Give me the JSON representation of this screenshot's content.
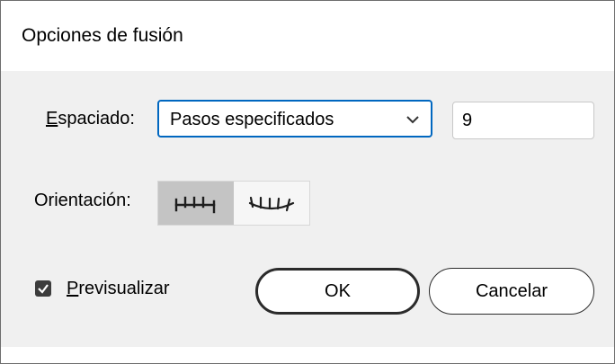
{
  "dialog": {
    "title": "Opciones de fusión"
  },
  "spacing": {
    "label_first": "E",
    "label_rest": "spaciado:",
    "selected_option": "Pasos especificados",
    "value": "9"
  },
  "orientation": {
    "label": "Orientación:",
    "options": [
      {
        "icon": "align-to-page-icon",
        "selected": true
      },
      {
        "icon": "align-to-path-icon",
        "selected": false
      }
    ]
  },
  "preview": {
    "checked": true,
    "label_first": "P",
    "label_rest": "revisualizar"
  },
  "buttons": {
    "ok": "OK",
    "cancel": "Cancelar"
  }
}
